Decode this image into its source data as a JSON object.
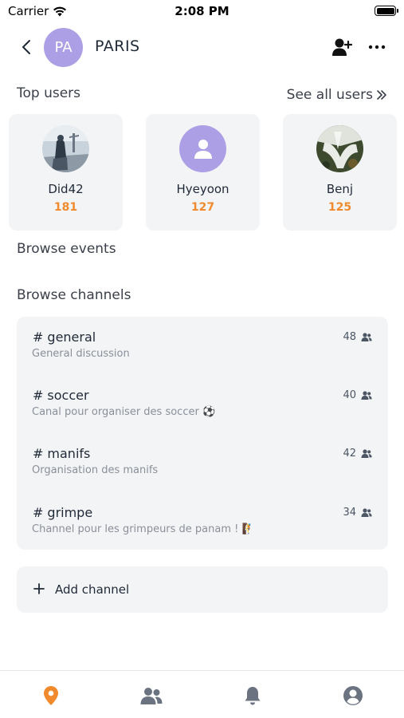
{
  "status_bar": {
    "carrier": "Carrier",
    "time": "2:08 PM"
  },
  "header": {
    "avatar_initials": "PA",
    "title": "PARIS",
    "avatar_color": "#ad9fe6"
  },
  "top_users": {
    "title": "Top users",
    "see_all_label": "See all users",
    "users": [
      {
        "name": "Did42",
        "score": "181"
      },
      {
        "name": "Hyeyoon",
        "score": "127"
      },
      {
        "name": "Benj",
        "score": "125"
      }
    ]
  },
  "browse_events": {
    "title": "Browse events"
  },
  "browse_channels": {
    "title": "Browse channels",
    "channels": [
      {
        "hash": "#",
        "name": "general",
        "description": "General discussion",
        "members": "48"
      },
      {
        "hash": "#",
        "name": "soccer",
        "description": "Canal pour organiser des soccer ⚽",
        "members": "40"
      },
      {
        "hash": "#",
        "name": "manifs",
        "description": "Organisation des manifs",
        "members": "42"
      },
      {
        "hash": "#",
        "name": "grimpe",
        "description": "Channel pour les grimpeurs de panam ! 🧗",
        "members": "34"
      }
    ],
    "add_channel_label": "Add channel"
  },
  "tabs": [
    {
      "icon": "location-pin-icon",
      "active": true
    },
    {
      "icon": "users-icon",
      "active": false
    },
    {
      "icon": "bell-icon",
      "active": false
    },
    {
      "icon": "profile-icon",
      "active": false
    }
  ],
  "colors": {
    "accent": "#f08a2c",
    "card_bg": "#f3f4f6",
    "text_muted": "#8a8f99",
    "tab_inactive": "#6b7280"
  }
}
